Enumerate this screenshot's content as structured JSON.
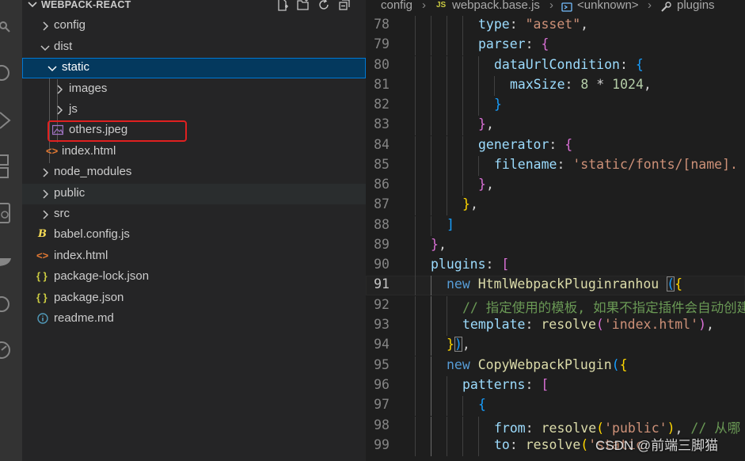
{
  "sidebar": {
    "title": "WEBPACK-REACT",
    "tree": [
      {
        "label": "config",
        "type": "folder",
        "expanded": false
      },
      {
        "label": "dist",
        "type": "folder",
        "expanded": true
      },
      {
        "label": "static",
        "type": "folder",
        "expanded": true,
        "selected": true
      },
      {
        "label": "images",
        "type": "folder",
        "expanded": false
      },
      {
        "label": "js",
        "type": "folder",
        "expanded": false
      },
      {
        "label": "others.jpeg",
        "type": "image-file",
        "highlighted": true
      },
      {
        "label": "index.html",
        "type": "html-file"
      },
      {
        "label": "node_modules",
        "type": "folder",
        "expanded": false
      },
      {
        "label": "public",
        "type": "folder",
        "expanded": false
      },
      {
        "label": "src",
        "type": "folder",
        "expanded": false
      },
      {
        "label": "babel.config.js",
        "type": "babel-file"
      },
      {
        "label": "index.html",
        "type": "html-file"
      },
      {
        "label": "package-lock.json",
        "type": "json-file"
      },
      {
        "label": "package.json",
        "type": "json-file"
      },
      {
        "label": "readme.md",
        "type": "info-file"
      }
    ]
  },
  "breadcrumb": {
    "items": [
      "config",
      "webpack.base.js",
      "<unknown>",
      "plugins"
    ],
    "file_badge": "JS"
  },
  "editor": {
    "line_numbers": [
      "78",
      "79",
      "80",
      "81",
      "82",
      "83",
      "84",
      "85",
      "86",
      "87",
      "88",
      "89",
      "90",
      "91",
      "92",
      "93",
      "94",
      "95",
      "96",
      "97",
      "98",
      "99"
    ],
    "current_line": "91"
  },
  "watermark": "CSDN @前端三脚猫",
  "colors": {
    "selection": "#04395e",
    "focus_border": "#0078d4",
    "highlight_box": "#e02020",
    "keyword": "#569cd6",
    "property": "#9cdcfe",
    "string": "#ce9178"
  }
}
